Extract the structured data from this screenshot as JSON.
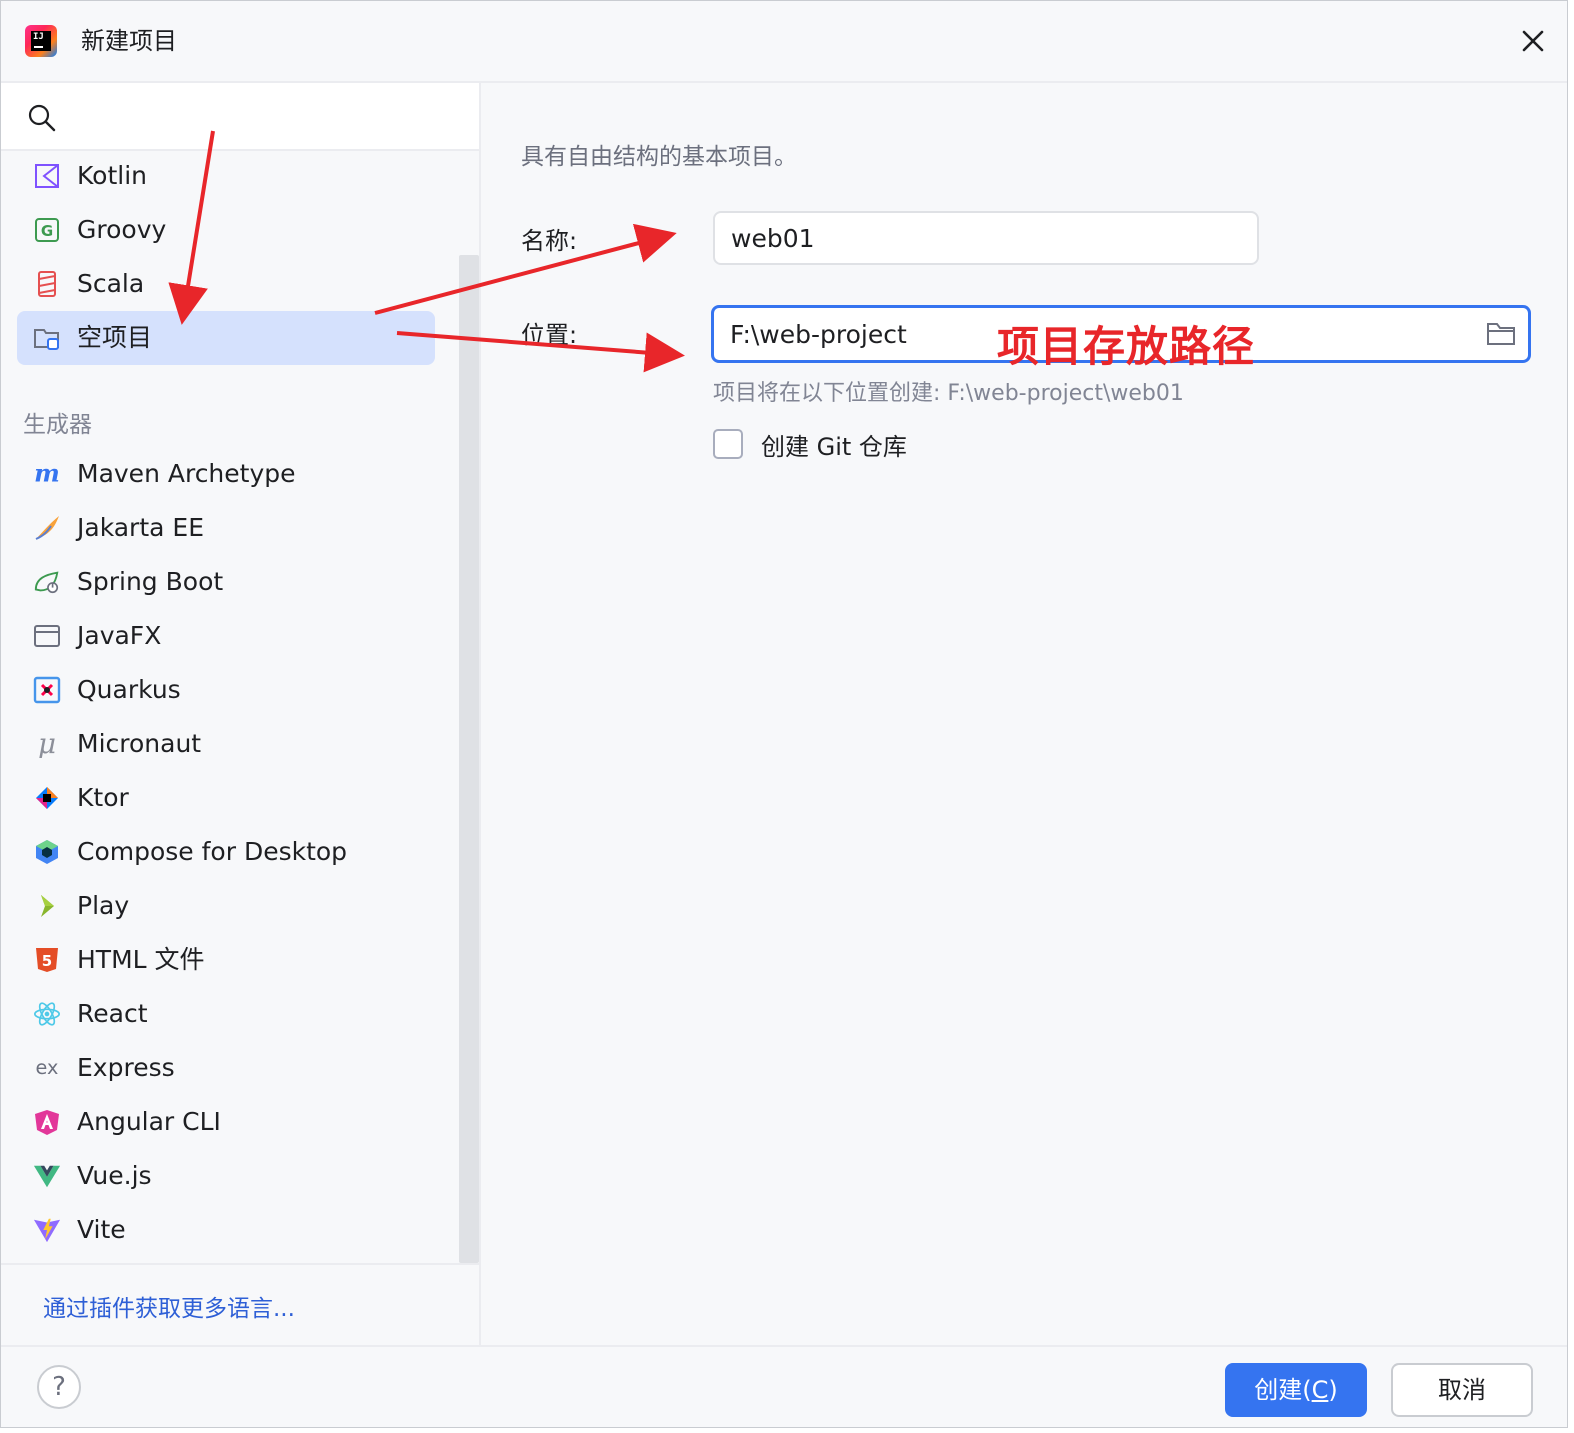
{
  "window": {
    "title": "新建项目",
    "app_icon": "intellij-idea-icon",
    "close_icon": "close-icon"
  },
  "sidebar": {
    "search": {
      "value": "",
      "placeholder": ""
    },
    "items": [
      {
        "label": "Kotlin",
        "icon": "kotlin-icon",
        "selected": false
      },
      {
        "label": "Groovy",
        "icon": "groovy-icon",
        "selected": false
      },
      {
        "label": "Scala",
        "icon": "scala-icon",
        "selected": false
      },
      {
        "label": "空项目",
        "icon": "empty-project-icon",
        "selected": true
      }
    ],
    "generators_label": "生成器",
    "generators": [
      {
        "label": "Maven Archetype",
        "icon": "maven-icon"
      },
      {
        "label": "Jakarta EE",
        "icon": "jakarta-ee-icon"
      },
      {
        "label": "Spring Boot",
        "icon": "spring-boot-icon"
      },
      {
        "label": "JavaFX",
        "icon": "javafx-icon"
      },
      {
        "label": "Quarkus",
        "icon": "quarkus-icon"
      },
      {
        "label": "Micronaut",
        "icon": "micronaut-icon"
      },
      {
        "label": "Ktor",
        "icon": "ktor-icon"
      },
      {
        "label": "Compose for Desktop",
        "icon": "compose-icon"
      },
      {
        "label": "Play",
        "icon": "play-icon"
      },
      {
        "label": "HTML 文件",
        "icon": "html5-icon"
      },
      {
        "label": "React",
        "icon": "react-icon"
      },
      {
        "label": "Express",
        "icon": "express-icon"
      },
      {
        "label": "Angular CLI",
        "icon": "angular-icon"
      },
      {
        "label": "Vue.js",
        "icon": "vue-icon"
      },
      {
        "label": "Vite",
        "icon": "vite-icon"
      }
    ],
    "more_link": "通过插件获取更多语言..."
  },
  "main": {
    "description": "具有自由结构的基本项目。",
    "name_label": "名称:",
    "name_value": "web01",
    "location_label": "位置:",
    "location_value": "F:\\web-project",
    "location_hint": "项目将在以下位置创建: F:\\web-project\\web01",
    "git_checkbox_label": "创建 Git 仓库",
    "git_checked": false,
    "annotation": "项目存放路径"
  },
  "footer": {
    "help_label": "?",
    "create_label": "创建(",
    "create_mnemonic": "C",
    "create_close": ")",
    "cancel_label": "取消"
  },
  "colors": {
    "accent": "#3574f0",
    "selection": "#d5e1fd",
    "annotation_red": "#e8262a"
  }
}
